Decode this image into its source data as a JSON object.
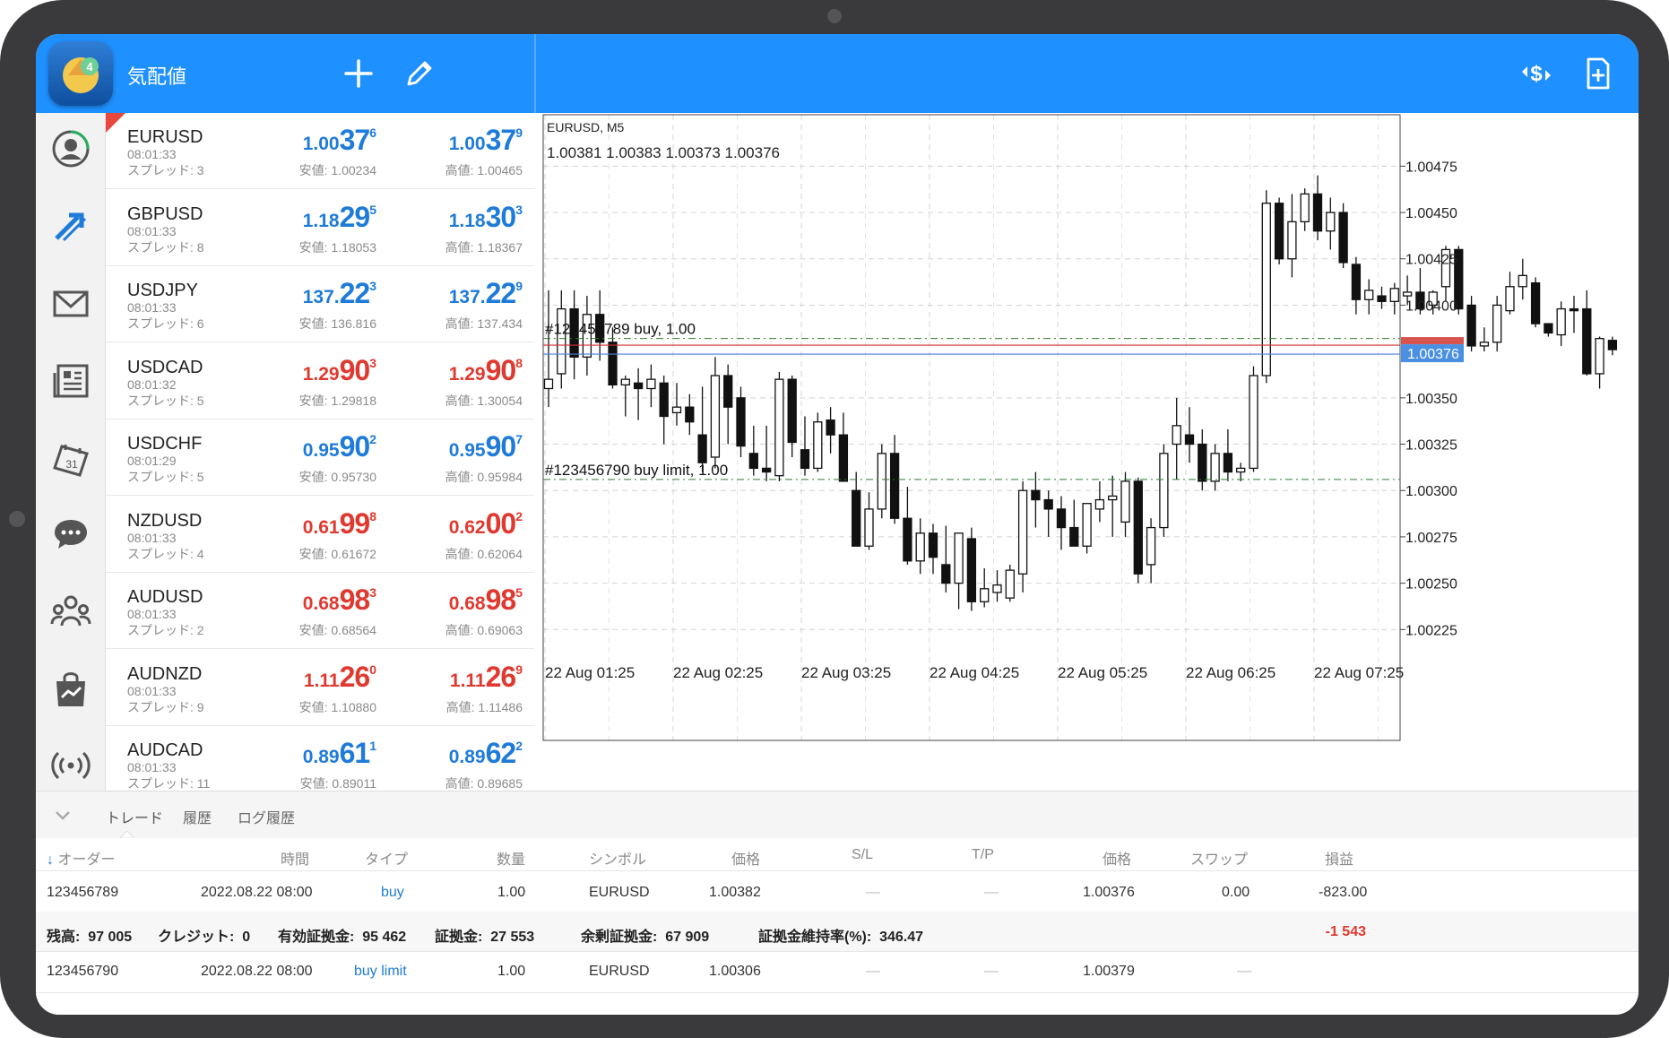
{
  "app": {
    "title": "気配値",
    "header_icons": [
      "add-icon",
      "edit-icon",
      "symbol-change-icon",
      "new-order-icon"
    ]
  },
  "sidebar": {
    "items": [
      "account-icon",
      "trade-arrows-icon",
      "mail-icon",
      "news-icon",
      "calendar-icon",
      "chat-icon",
      "community-icon",
      "market-icon",
      "signals-icon"
    ]
  },
  "quotes": [
    {
      "symbol": "EURUSD",
      "time": "08:01:33",
      "spread": "スプレッド: 3",
      "color": "blue",
      "bid": {
        "pre": "1.00",
        "big": "37",
        "sup": "6"
      },
      "ask": {
        "pre": "1.00",
        "big": "37",
        "sup": "9"
      },
      "low": "安値: 1.00234",
      "high": "高値: 1.00465"
    },
    {
      "symbol": "GBPUSD",
      "time": "08:01:33",
      "spread": "スプレッド: 8",
      "color": "blue",
      "bid": {
        "pre": "1.18",
        "big": "29",
        "sup": "5"
      },
      "ask": {
        "pre": "1.18",
        "big": "30",
        "sup": "3"
      },
      "low": "安値: 1.18053",
      "high": "高値: 1.18367"
    },
    {
      "symbol": "USDJPY",
      "time": "08:01:33",
      "spread": "スプレッド: 6",
      "color": "blue",
      "bid": {
        "pre": "137.",
        "big": "22",
        "sup": "3"
      },
      "ask": {
        "pre": "137.",
        "big": "22",
        "sup": "9"
      },
      "low": "安値: 136.816",
      "high": "高値: 137.434"
    },
    {
      "symbol": "USDCAD",
      "time": "08:01:32",
      "spread": "スプレッド: 5",
      "color": "red",
      "bid": {
        "pre": "1.29",
        "big": "90",
        "sup": "3"
      },
      "ask": {
        "pre": "1.29",
        "big": "90",
        "sup": "8"
      },
      "low": "安値: 1.29818",
      "high": "高値: 1.30054"
    },
    {
      "symbol": "USDCHF",
      "time": "08:01:29",
      "spread": "スプレッド: 5",
      "color": "blue",
      "bid": {
        "pre": "0.95",
        "big": "90",
        "sup": "2"
      },
      "ask": {
        "pre": "0.95",
        "big": "90",
        "sup": "7"
      },
      "low": "安値: 0.95730",
      "high": "高値: 0.95984"
    },
    {
      "symbol": "NZDUSD",
      "time": "08:01:33",
      "spread": "スプレッド: 4",
      "color": "red",
      "bid": {
        "pre": "0.61",
        "big": "99",
        "sup": "8"
      },
      "ask": {
        "pre": "0.62",
        "big": "00",
        "sup": "2"
      },
      "low": "安値: 0.61672",
      "high": "高値: 0.62064"
    },
    {
      "symbol": "AUDUSD",
      "time": "08:01:33",
      "spread": "スプレッド: 2",
      "color": "red",
      "bid": {
        "pre": "0.68",
        "big": "98",
        "sup": "3"
      },
      "ask": {
        "pre": "0.68",
        "big": "98",
        "sup": "5"
      },
      "low": "安値: 0.68564",
      "high": "高値: 0.69063"
    },
    {
      "symbol": "AUDNZD",
      "time": "08:01:33",
      "spread": "スプレッド: 9",
      "color": "red",
      "bid": {
        "pre": "1.11",
        "big": "26",
        "sup": "0"
      },
      "ask": {
        "pre": "1.11",
        "big": "26",
        "sup": "9"
      },
      "low": "安値: 1.10880",
      "high": "高値: 1.11486"
    },
    {
      "symbol": "AUDCAD",
      "time": "08:01:33",
      "spread": "スプレッド: 11",
      "color": "blue",
      "bid": {
        "pre": "0.89",
        "big": "61",
        "sup": "1"
      },
      "ask": {
        "pre": "0.89",
        "big": "62",
        "sup": "2"
      },
      "low": "安値: 0.89011",
      "high": "高値: 0.89685"
    }
  ],
  "chart": {
    "symbol_tf": "EURUSD, M5",
    "ohlc": "1.00381 1.00383 1.00373 1.00376",
    "y_ticks": [
      "1.00475",
      "1.00450",
      "1.00425",
      "1.00400",
      "1.00350",
      "1.00325",
      "1.00300",
      "1.00275",
      "1.00250",
      "1.00225"
    ],
    "x_ticks": [
      "22 Aug 01:25",
      "22 Aug 02:25",
      "22 Aug 03:25",
      "22 Aug 04:25",
      "22 Aug 05:25",
      "22 Aug 06:25",
      "22 Aug 07:25"
    ],
    "current_price": "1.00376",
    "order_line_1": "#123456789 buy, 1.00",
    "order_line_2": "#123456790 buy limit, 1.00",
    "colors": {
      "bid_line": "#d32f2f",
      "ask_line": "#4a7fd4",
      "order_line": "#2e7d32",
      "price_tag": "#4a90e2"
    }
  },
  "chart_data": {
    "type": "candlestick",
    "ylim": [
      1.002,
      1.00495
    ],
    "x_start": "22 Aug 01:15",
    "interval": "5 min",
    "order_levels": [
      1.00382,
      1.00306
    ],
    "bid": 1.00376,
    "ohlc": [
      [
        1.00355,
        1.00408,
        1.00345,
        1.0036
      ],
      [
        1.00363,
        1.00408,
        1.00355,
        1.00398
      ],
      [
        1.00398,
        1.00408,
        1.0036,
        1.00372
      ],
      [
        1.00372,
        1.00405,
        1.00362,
        1.00395
      ],
      [
        1.00395,
        1.00408,
        1.0037,
        1.0038
      ],
      [
        1.0038,
        1.00388,
        1.00355,
        1.00357
      ],
      [
        1.00357,
        1.00362,
        1.0034,
        1.0036
      ],
      [
        1.00358,
        1.00366,
        1.00338,
        1.00355
      ],
      [
        1.00355,
        1.00368,
        1.00345,
        1.0036
      ],
      [
        1.00358,
        1.00362,
        1.00325,
        1.0034
      ],
      [
        1.00342,
        1.00358,
        1.00335,
        1.00345
      ],
      [
        1.00345,
        1.00352,
        1.0033,
        1.00337
      ],
      [
        1.0033,
        1.00356,
        1.0031,
        1.00315
      ],
      [
        1.00318,
        1.00372,
        1.00312,
        1.00362
      ],
      [
        1.00362,
        1.00368,
        1.00325,
        1.00345
      ],
      [
        1.0035,
        1.00356,
        1.00318,
        1.00324
      ],
      [
        1.0032,
        1.00335,
        1.00308,
        1.00312
      ],
      [
        1.00312,
        1.00335,
        1.00305,
        1.0031
      ],
      [
        1.00308,
        1.00364,
        1.00305,
        1.0036
      ],
      [
        1.0036,
        1.00362,
        1.00318,
        1.00326
      ],
      [
        1.00322,
        1.0034,
        1.00308,
        1.00312
      ],
      [
        1.00312,
        1.00342,
        1.0031,
        1.00337
      ],
      [
        1.00338,
        1.00345,
        1.0032,
        1.0033
      ],
      [
        1.0033,
        1.00342,
        1.00318,
        1.00305
      ],
      [
        1.003,
        1.0031,
        1.0027,
        1.0027
      ],
      [
        1.0027,
        1.00299,
        1.00268,
        1.0029
      ],
      [
        1.0029,
        1.00325,
        1.00285,
        1.0032
      ],
      [
        1.0032,
        1.0033,
        1.00282,
        1.00285
      ],
      [
        1.00285,
        1.00302,
        1.0026,
        1.00262
      ],
      [
        1.00262,
        1.00285,
        1.00255,
        1.00277
      ],
      [
        1.00277,
        1.00282,
        1.00255,
        1.00264
      ],
      [
        1.0026,
        1.00281,
        1.00245,
        1.0025
      ],
      [
        1.0025,
        1.00275,
        1.00236,
        1.00277
      ],
      [
        1.00274,
        1.0028,
        1.00235,
        1.0024
      ],
      [
        1.0024,
        1.00258,
        1.00237,
        1.00247
      ],
      [
        1.00245,
        1.00257,
        1.0024,
        1.00249
      ],
      [
        1.00242,
        1.0026,
        1.0024,
        1.00257
      ],
      [
        1.00255,
        1.00305,
        1.00245,
        1.003
      ],
      [
        1.003,
        1.0031,
        1.0028,
        1.00295
      ],
      [
        1.00295,
        1.003,
        1.00275,
        1.0029
      ],
      [
        1.0029,
        1.00297,
        1.00268,
        1.0028
      ],
      [
        1.0028,
        1.00295,
        1.0027,
        1.0027
      ],
      [
        1.0027,
        1.00293,
        1.00266,
        1.00293
      ],
      [
        1.0029,
        1.00305,
        1.00283,
        1.00295
      ],
      [
        1.00295,
        1.00308,
        1.00275,
        1.00297
      ],
      [
        1.00283,
        1.0031,
        1.00275,
        1.00305
      ],
      [
        1.00305,
        1.00307,
        1.0025,
        1.00255
      ],
      [
        1.0026,
        1.00285,
        1.0025,
        1.0028
      ],
      [
        1.0028,
        1.00325,
        1.00275,
        1.0032
      ],
      [
        1.00325,
        1.0035,
        1.00306,
        1.00335
      ],
      [
        1.0033,
        1.00345,
        1.00315,
        1.00325
      ],
      [
        1.00325,
        1.00333,
        1.003,
        1.00305
      ],
      [
        1.00305,
        1.00325,
        1.003,
        1.0032
      ],
      [
        1.0032,
        1.00333,
        1.00305,
        1.0031
      ],
      [
        1.0031,
        1.00315,
        1.00305,
        1.00312
      ],
      [
        1.00312,
        1.00367,
        1.0031,
        1.00362
      ],
      [
        1.00362,
        1.00462,
        1.00358,
        1.00455
      ],
      [
        1.00455,
        1.00458,
        1.00422,
        1.00425
      ],
      [
        1.00425,
        1.0046,
        1.00415,
        1.00445
      ],
      [
        1.00445,
        1.00463,
        1.0044,
        1.0046
      ],
      [
        1.0046,
        1.0047,
        1.00435,
        1.0044
      ],
      [
        1.0044,
        1.00458,
        1.0043,
        1.0045
      ],
      [
        1.0045,
        1.00455,
        1.0042,
        1.00423
      ],
      [
        1.00422,
        1.00426,
        1.00395,
        1.00403
      ],
      [
        1.00403,
        1.00414,
        1.00395,
        1.00408
      ],
      [
        1.00405,
        1.0041,
        1.00398,
        1.00402
      ],
      [
        1.00402,
        1.00412,
        1.00395,
        1.00409
      ],
      [
        1.00405,
        1.00416,
        1.004,
        1.00407
      ],
      [
        1.00407,
        1.0042,
        1.00395,
        1.00398
      ],
      [
        1.004,
        1.00408,
        1.00395,
        1.00407
      ],
      [
        1.0041,
        1.00432,
        1.00402,
        1.0043
      ],
      [
        1.0043,
        1.00432,
        1.00395,
        1.00398
      ],
      [
        1.004,
        1.00405,
        1.00375,
        1.00378
      ],
      [
        1.00378,
        1.00388,
        1.00375,
        1.0038
      ],
      [
        1.0038,
        1.00405,
        1.00375,
        1.004
      ],
      [
        1.00397,
        1.00418,
        1.00395,
        1.0041
      ],
      [
        1.0041,
        1.00425,
        1.00403,
        1.00416
      ],
      [
        1.00412,
        1.00415,
        1.00388,
        1.0039
      ],
      [
        1.0039,
        1.0039,
        1.00383,
        1.00385
      ],
      [
        1.00384,
        1.00402,
        1.00378,
        1.00398
      ],
      [
        1.00398,
        1.00405,
        1.00385,
        1.00397
      ],
      [
        1.00398,
        1.00408,
        1.00362,
        1.00363
      ],
      [
        1.00363,
        1.00383,
        1.00355,
        1.00382
      ],
      [
        1.00381,
        1.00383,
        1.00373,
        1.00376
      ]
    ]
  },
  "terminal": {
    "tabs": [
      "トレード",
      "履歴",
      "ログ履歴"
    ],
    "columns": [
      "オーダー",
      "時間",
      "タイプ",
      "数量",
      "シンボル",
      "価格",
      "S/L",
      "T/P",
      "価格",
      "スワップ",
      "損益"
    ],
    "rows": [
      {
        "order": "123456789",
        "time": "2022.08.22 08:00",
        "type": "buy",
        "volume": "1.00",
        "symbol": "EURUSD",
        "open_price": "1.00382",
        "sl": "—",
        "tp": "—",
        "price": "1.00376",
        "swap": "0.00",
        "profit": "-823.00"
      },
      {
        "order": "123456790",
        "time": "2022.08.22 08:00",
        "type": "buy limit",
        "volume": "1.00",
        "symbol": "EURUSD",
        "open_price": "1.00306",
        "sl": "—",
        "tp": "—",
        "price": "1.00379",
        "swap": "—",
        "profit": ""
      }
    ],
    "summary": {
      "balance_label": "残高:",
      "balance": "97 005",
      "credit_label": "クレジット:",
      "credit": "0",
      "equity_label": "有効証拠金:",
      "equity": "95 462",
      "margin_label": "証拠金:",
      "margin": "27 553",
      "free_margin_label": "余剰証拠金:",
      "free_margin": "67 909",
      "margin_level_label": "証拠金維持率(%):",
      "margin_level": "346.47",
      "total_profit": "-1 543"
    }
  }
}
